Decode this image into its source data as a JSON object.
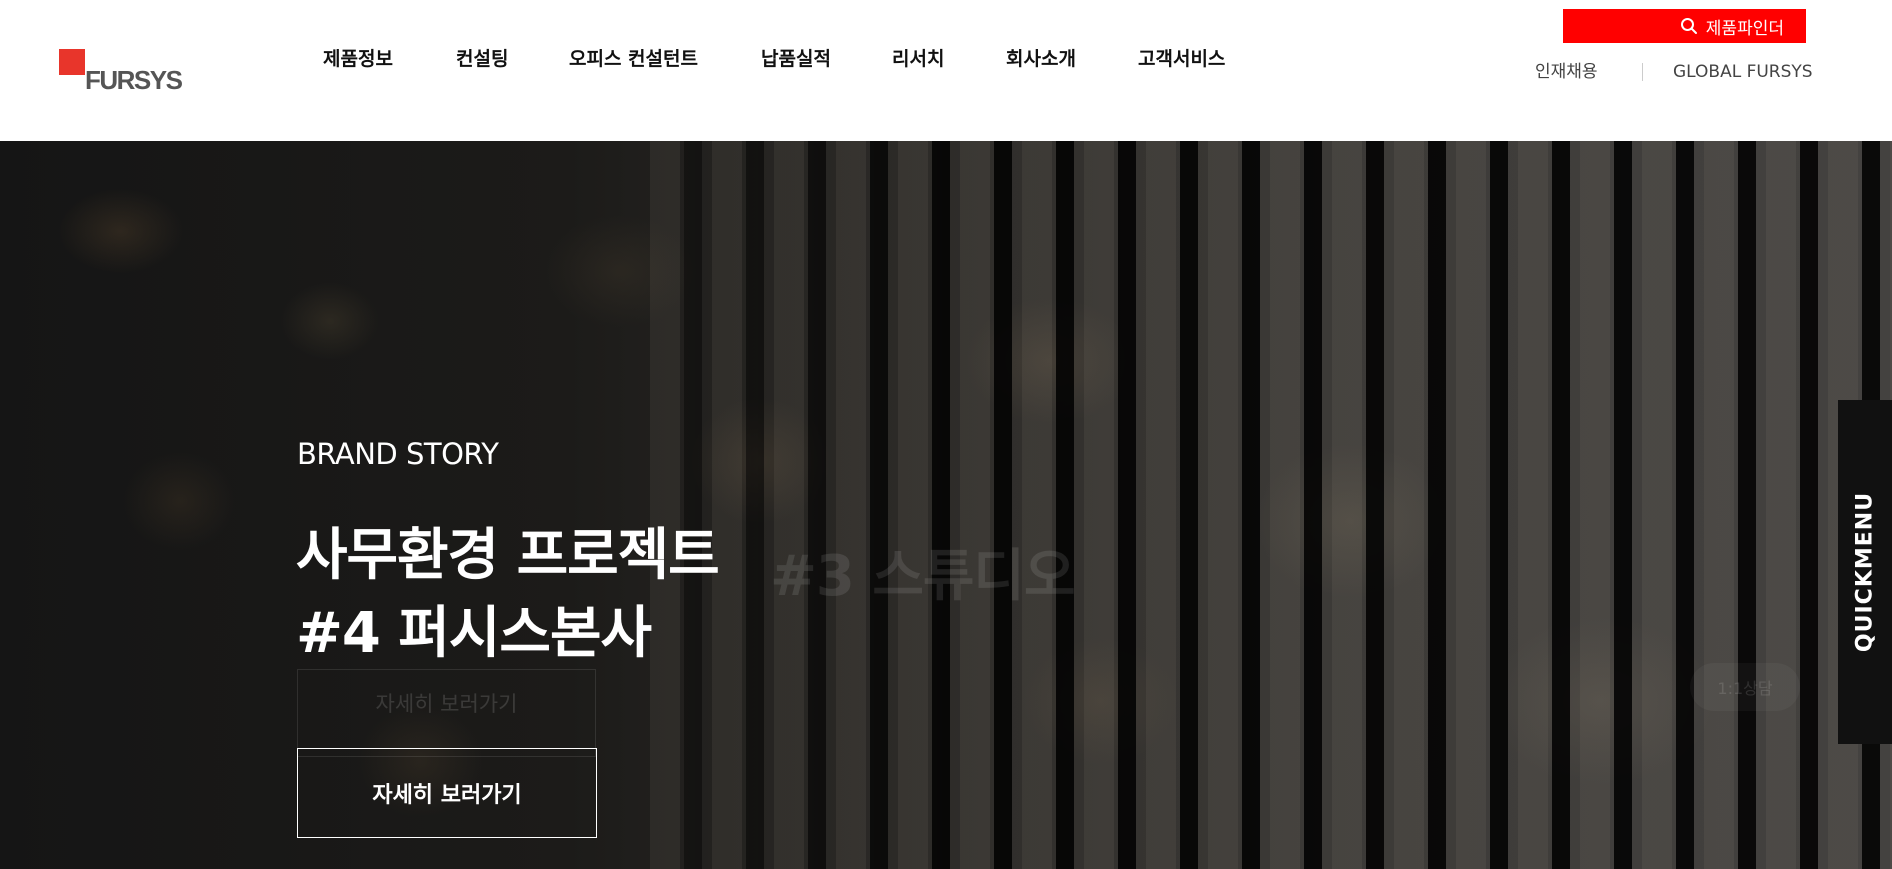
{
  "brand": {
    "logo_text": "FURSYS",
    "accent_color": "#e8352b"
  },
  "gnb": {
    "items": [
      {
        "label": "제품정보"
      },
      {
        "label": "컨설팅"
      },
      {
        "label": "오피스 컨설턴트"
      },
      {
        "label": "납품실적"
      },
      {
        "label": "리서치"
      },
      {
        "label": "회사소개"
      },
      {
        "label": "고객서비스"
      }
    ]
  },
  "utility": {
    "finder_label": "제품파인더",
    "finder_icon": "search-icon",
    "finder_color": "#ff0000",
    "careers_label": "인재채용",
    "global_label": "GLOBAL FURSYS"
  },
  "hero": {
    "category": "BRAND STORY",
    "title_line1": "사무환경 프로젝트",
    "title_line2": "#4 퍼시스본사",
    "button_label": "자세히 보러가기",
    "ghost_title": "#3 스튜디오",
    "ghost_button_label": "자세히 보러가기",
    "ghost_chat_label": "1:1상담"
  },
  "quickmenu": {
    "label": "QUICKMENU"
  }
}
